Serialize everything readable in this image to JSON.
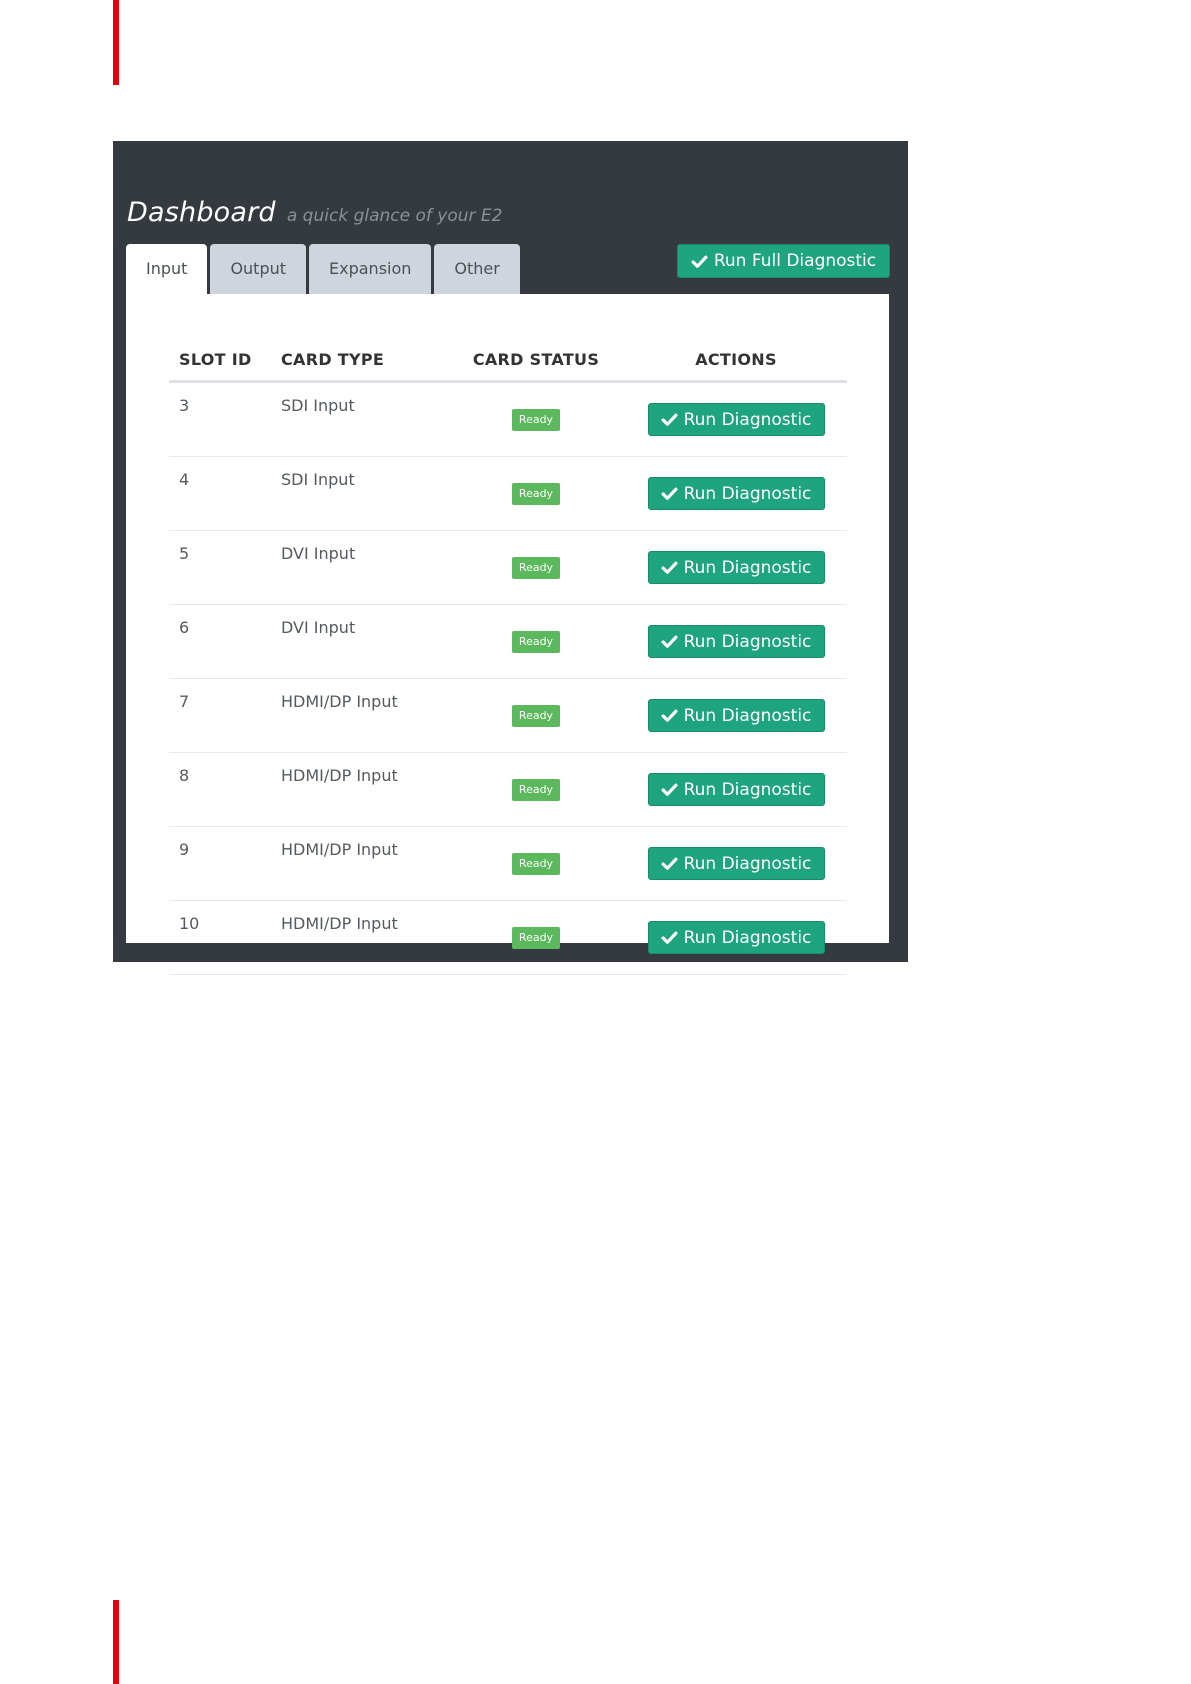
{
  "dashboard": {
    "title": "Dashboard",
    "subtitle": "a quick glance of your E2"
  },
  "tabs": [
    {
      "label": "Input",
      "active": true
    },
    {
      "label": "Output",
      "active": false
    },
    {
      "label": "Expansion",
      "active": false
    },
    {
      "label": "Other",
      "active": false
    }
  ],
  "full_diagnostic_label": "Run Full Diagnostic",
  "table": {
    "headers": [
      "SLOT ID",
      "CARD TYPE",
      "CARD STATUS",
      "ACTIONS"
    ],
    "rows": [
      {
        "slot": "3",
        "type": "SDI Input",
        "status": "Ready",
        "action": "Run Diagnostic"
      },
      {
        "slot": "4",
        "type": "SDI Input",
        "status": "Ready",
        "action": "Run Diagnostic"
      },
      {
        "slot": "5",
        "type": "DVI Input",
        "status": "Ready",
        "action": "Run Diagnostic"
      },
      {
        "slot": "6",
        "type": "DVI Input",
        "status": "Ready",
        "action": "Run Diagnostic"
      },
      {
        "slot": "7",
        "type": "HDMI/DP Input",
        "status": "Ready",
        "action": "Run Diagnostic"
      },
      {
        "slot": "8",
        "type": "HDMI/DP Input",
        "status": "Ready",
        "action": "Run Diagnostic"
      },
      {
        "slot": "9",
        "type": "HDMI/DP Input",
        "status": "Ready",
        "action": "Run Diagnostic"
      },
      {
        "slot": "10",
        "type": "HDMI/DP Input",
        "status": "Ready",
        "action": "Run Diagnostic"
      }
    ]
  },
  "colors": {
    "panel_background": "#343a40",
    "accent_green": "#1ea47e",
    "status_green": "#5cb85c",
    "page_marker_red": "#e3000f"
  },
  "icons": {
    "button_icon": "check-icon"
  }
}
